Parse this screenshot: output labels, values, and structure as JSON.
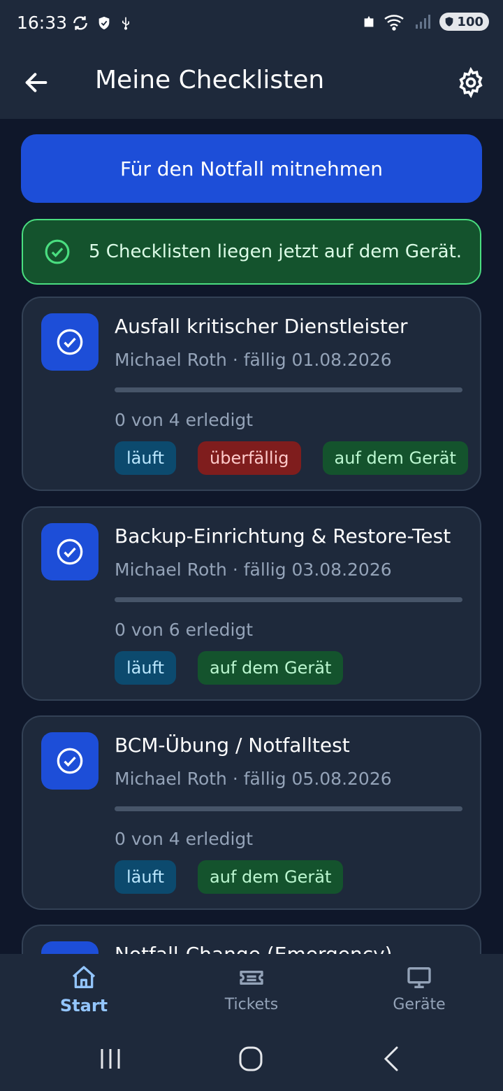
{
  "status_bar": {
    "time": "16:33",
    "battery": "100",
    "icons": [
      "sync-icon",
      "shield-icon",
      "usb-icon",
      "alert-icon",
      "wifi-icon",
      "signal-icon",
      "battery-icon"
    ]
  },
  "app_bar": {
    "title": "Meine Checklisten",
    "back_icon": "arrow-left-icon",
    "settings_icon": "gear-icon"
  },
  "actions": {
    "primary_label": "Für den Notfall mitnehmen"
  },
  "notice": {
    "text": "5 Checklisten liegen jetzt auf dem Gerät."
  },
  "checklists": [
    {
      "title": "Ausfall kritischer Dienstleister",
      "meta": "Michael Roth · fällig 01.08.2026",
      "progress_fraction": 0,
      "count": "0 von 4 erledigt",
      "badges": {
        "running": "läuft",
        "overdue": "überfällig",
        "device": "auf dem Gerät"
      }
    },
    {
      "title": "Backup-Einrichtung & Restore-Test",
      "meta": "Michael Roth · fällig 03.08.2026",
      "progress_fraction": 0,
      "count": "0 von 6 erledigt",
      "badges": {
        "running": "läuft",
        "device": "auf dem Gerät"
      }
    },
    {
      "title": "BCM-Übung / Notfalltest",
      "meta": "Michael Roth · fällig 05.08.2026",
      "progress_fraction": 0,
      "count": "0 von 4 erledigt",
      "badges": {
        "running": "läuft",
        "device": "auf dem Gerät"
      }
    },
    {
      "title": "Notfall-Change (Emergency)"
    }
  ],
  "bottom_nav": [
    {
      "label": "Start",
      "icon": "home-icon",
      "active": true
    },
    {
      "label": "Tickets",
      "icon": "ticket-icon",
      "active": false
    },
    {
      "label": "Geräte",
      "icon": "monitor-icon",
      "active": false
    }
  ],
  "system_nav": [
    "recents-icon",
    "home-circle-icon",
    "back-chevron-icon"
  ],
  "colors": {
    "background": "#0f172a",
    "surface": "#1e293b",
    "accent": "#1d4ed8",
    "success": "#4ade80",
    "active_nav": "#93c5fd"
  }
}
